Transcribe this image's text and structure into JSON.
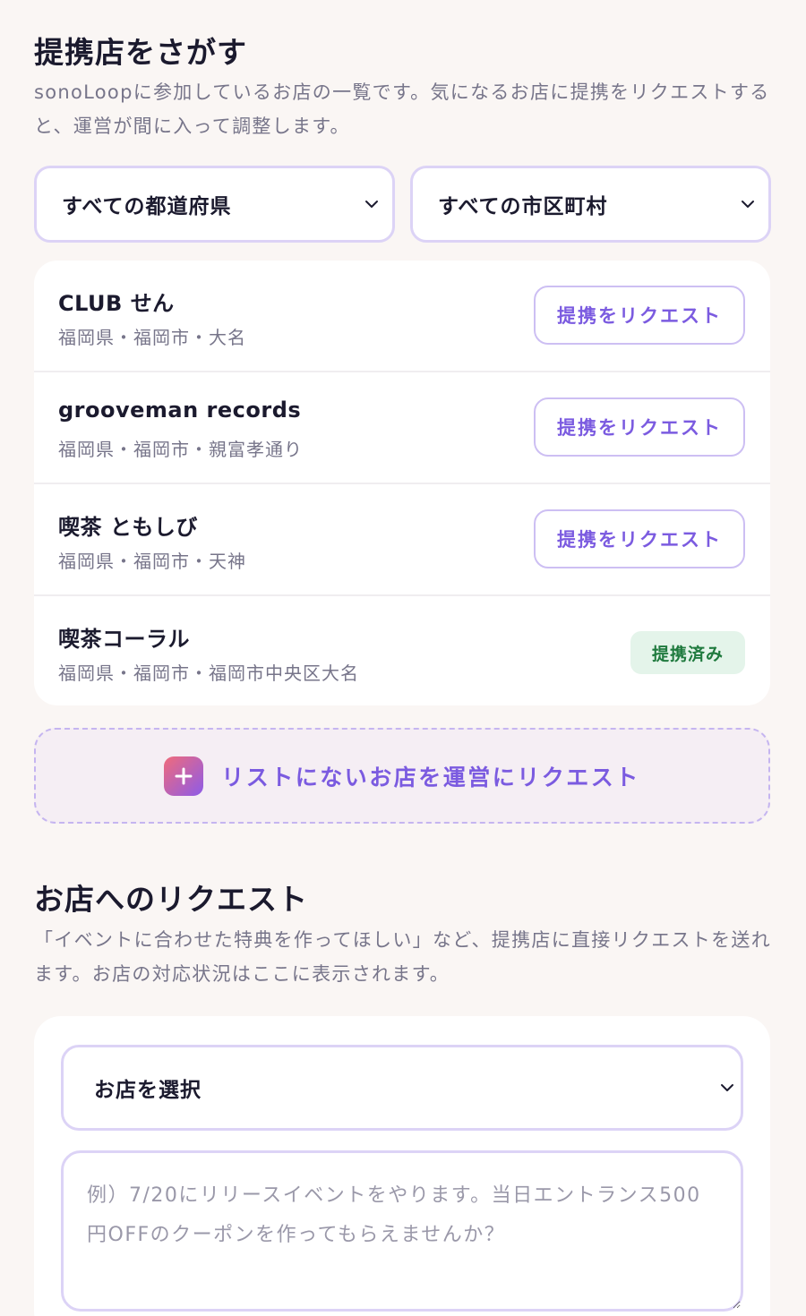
{
  "find_section": {
    "title": "提携店をさがす",
    "description": "sonoLoopに参加しているお店の一覧です。気になるお店に提携をリクエストすると、運営が間に入って調整します。"
  },
  "filters": {
    "prefecture": {
      "selected": "すべての都道府県"
    },
    "city": {
      "selected": "すべての市区町村"
    }
  },
  "shops": [
    {
      "name": "CLUB せん",
      "location": "福岡県・福岡市・大名",
      "status": "request",
      "action_label": "提携をリクエスト"
    },
    {
      "name": "grooveman records",
      "location": "福岡県・福岡市・親富孝通り",
      "status": "request",
      "action_label": "提携をリクエスト"
    },
    {
      "name": "喫茶 ともしび",
      "location": "福岡県・福岡市・天神",
      "status": "request",
      "action_label": "提携をリクエスト"
    },
    {
      "name": "喫茶コーラル",
      "location": "福岡県・福岡市・福岡市中央区大名",
      "status": "partnered",
      "action_label": "提携済み"
    }
  ],
  "unlisted_request": {
    "label": "リストにないお店を運営にリクエスト",
    "icon": "plus-icon"
  },
  "request_section": {
    "title": "お店へのリクエスト",
    "description": "「イベントに合わせた特典を作ってほしい」など、提携店に直接リクエストを送れます。お店の対応状況はここに表示されます。"
  },
  "request_form": {
    "shop_select": {
      "selected": "お店を選択"
    },
    "message": {
      "value": "",
      "placeholder": "例）7/20にリリースイベントをやります。当日エントランス500円OFFのクーポンを作ってもらえませんか？"
    }
  },
  "colors": {
    "background": "#faf6f4",
    "accent": "#7b5be0",
    "border": "#dcd3f6",
    "partnered_bg": "#e4f4ea",
    "partnered_text": "#1f7a3e"
  }
}
